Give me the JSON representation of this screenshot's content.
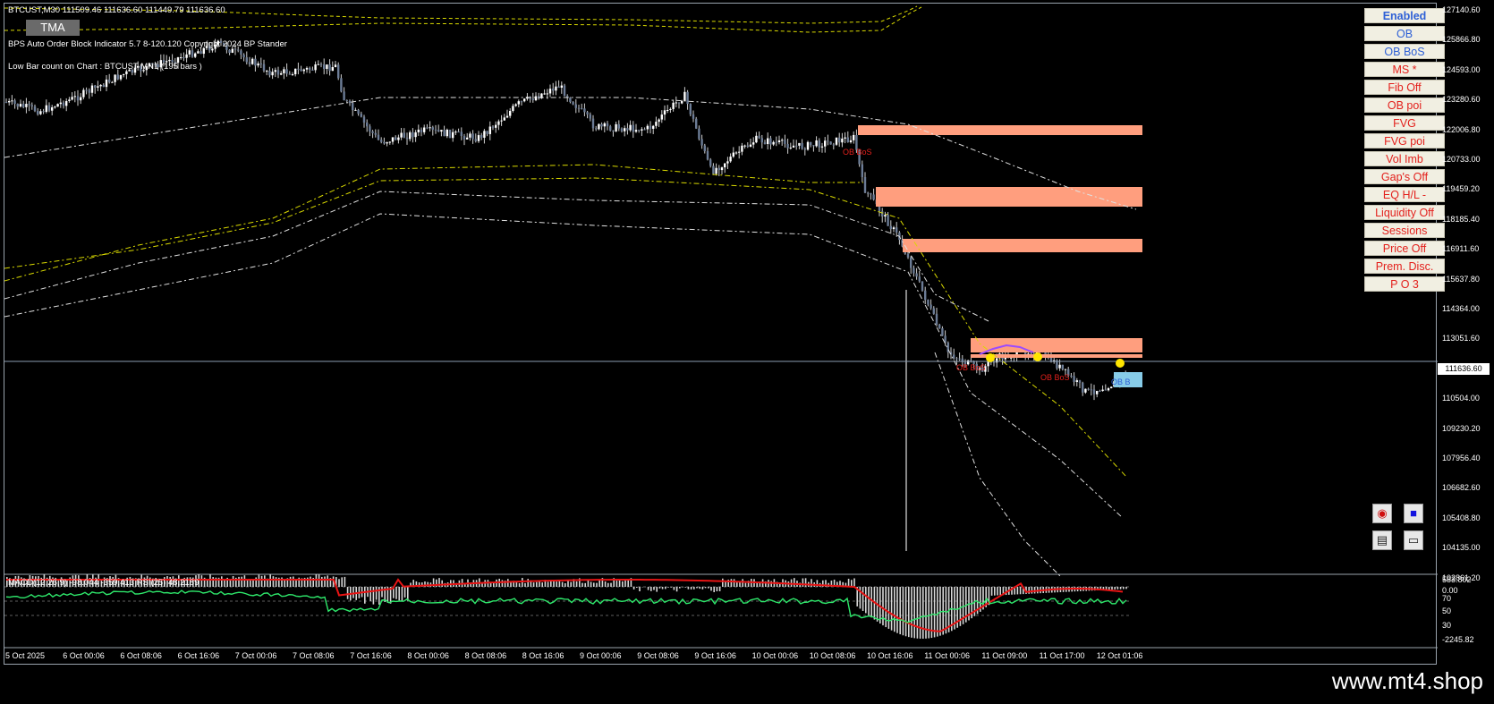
{
  "header": {
    "symbol_line": "BTCUST,M30  111509.46 111636.60 111449.79 111636.60",
    "indicator_line": "BPS Auto Order Block Indicator  5.7 8-120.120 Copyright 2024 BP Stander",
    "lowbar_line": "Low Bar count on Chart :  BTCUST   MN1   (195  bars   )",
    "tma_button": "TMA"
  },
  "panel_buttons": [
    {
      "label": "Enabled",
      "color": "#2e60d6"
    },
    {
      "label": "OB",
      "color": "#2e60d6"
    },
    {
      "label": "OB BoS",
      "color": "#2e60d6"
    },
    {
      "label": "MS *",
      "color": "#e3201c"
    },
    {
      "label": "Fib Off",
      "color": "#e3201c"
    },
    {
      "label": "OB poi",
      "color": "#e3201c"
    },
    {
      "label": "FVG",
      "color": "#e3201c"
    },
    {
      "label": "FVG poi",
      "color": "#e3201c"
    },
    {
      "label": "Vol Imb",
      "color": "#e3201c"
    },
    {
      "label": "Gap's Off",
      "color": "#e3201c"
    },
    {
      "label": "EQ H/L  -",
      "color": "#e3201c"
    },
    {
      "label": "Liquidity Off",
      "color": "#e3201c"
    },
    {
      "label": "Sessions",
      "color": "#e3201c"
    },
    {
      "label": "Price Off",
      "color": "#e3201c"
    },
    {
      "label": "Prem. Disc.",
      "color": "#e3201c"
    },
    {
      "label": "P O 3",
      "color": "#e3201c"
    }
  ],
  "price_axis": [
    "127140.60",
    "125866.80",
    "124593.00",
    "123280.60",
    "122006.80",
    "120733.00",
    "119459.20",
    "118185.40",
    "116911.60",
    "115637.80",
    "114364.00",
    "113051.60",
    "111777.80",
    "110504.00",
    "109230.20",
    "107956.40",
    "106682.60",
    "105408.80",
    "104135.00",
    "102861.20"
  ],
  "current_price": "111636.60",
  "time_axis": [
    "5 Oct 2025",
    "6 Oct 00:06",
    "6 Oct 08:06",
    "6 Oct 16:06",
    "7 Oct 00:06",
    "7 Oct 08:06",
    "7 Oct 16:06",
    "8 Oct 00:06",
    "8 Oct 08:06",
    "8 Oct 16:06",
    "9 Oct 00:06",
    "9 Oct 08:06",
    "9 Oct 16:06",
    "10 Oct 00:06",
    "10 Oct 08:06",
    "10 Oct 16:06",
    "11 Oct 00:06",
    "11 Oct 09:00",
    "11 Oct 17:00",
    "12 Oct 01:06"
  ],
  "indicator": {
    "title": "MACD(12,26,9) -98.044 -359.413  RSI(25) 48.2189",
    "axis_labels": [
      "583.802",
      "0.00",
      "70",
      "50",
      "30",
      "-2245.82"
    ]
  },
  "chart_labels": {
    "ob_bos_1": "OB BoS",
    "ob_bos_2": "OB BoS",
    "ob_bos_3": "OB BoS",
    "ob_bos_4": "OB B"
  },
  "controls": {
    "record_icon": "record-icon",
    "stop_icon": "stop-icon",
    "calc_icon": "calculator-icon",
    "screen_icon": "monitor-icon"
  },
  "watermark": "www.mt4.shop",
  "colors": {
    "background": "#000000",
    "order_block": "#ff9e7e",
    "bullish_block": "#87cce8",
    "macd_signal": "#e81414",
    "rsi": "#2ee86b",
    "tma_yellow": "#d9d900"
  }
}
